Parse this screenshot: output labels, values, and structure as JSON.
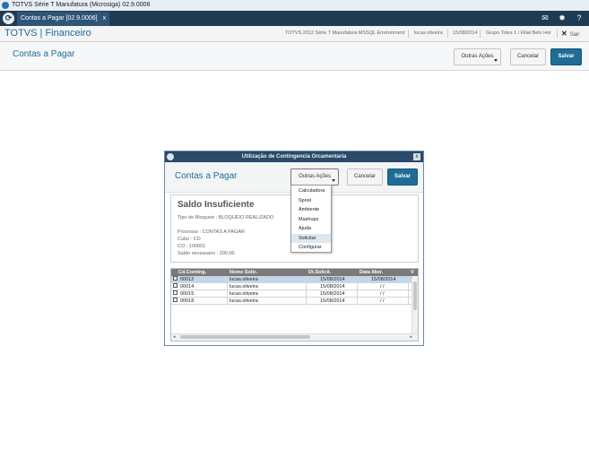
{
  "window": {
    "title": "TOTVS Série T Manufatura (Microsiga) 02.9.0006"
  },
  "tabbar": {
    "tab_label": "Contas a Pagar [02.9.0006]",
    "tab_close": "x",
    "mail_icon": "envelope-icon",
    "settings_icon": "gear-icon",
    "help_icon": "question-icon"
  },
  "module": {
    "name": "TOTVS | Financeiro",
    "environment": "TOTVS 2012 Série T Manufatura MSSQL Environment",
    "user": "lucas.oliveira",
    "date": "15/08/2014",
    "company": "Grupo Totvs 1 / Filial Belo Hor",
    "exit_label": "Sair",
    "exit_glyph": "✕"
  },
  "page": {
    "title": "Contas a Pagar",
    "other_actions": "Outras Ações",
    "cancel": "Cancelar",
    "save": "Salvar"
  },
  "dialog": {
    "title": "Utilização de Contingencia Orcamentaria",
    "close": "x",
    "header_title": "Contas a Pagar",
    "other_actions": "Outras Ações",
    "cancel": "Cancelar",
    "save": "Salvar",
    "panel": {
      "heading": "Saldo Insuficiente",
      "block_type": "Tipo de Bloqueio : BLOQUEIO REALIZADO",
      "process": "Processo : CONTAS A PAGAR",
      "cube": "Cubo : CD",
      "co": "CO : 100001",
      "balance": "Saldo necessario : 200,00"
    },
    "grid": {
      "columns": [
        "Cd.Conting.",
        "Nome Solic.",
        "Dt.Solicit.",
        "Data liber.",
        "V"
      ],
      "rows": [
        {
          "code": "00012",
          "name": "lucas.oliveira",
          "req_date": "15/08/2014",
          "release_date": "15/08/2014",
          "selected": true
        },
        {
          "code": "00014",
          "name": "lucas.oliveira",
          "req_date": "15/08/2014",
          "release_date": "/ /",
          "selected": false
        },
        {
          "code": "00015",
          "name": "lucas.oliveira",
          "req_date": "15/08/2014",
          "release_date": "/ /",
          "selected": false
        },
        {
          "code": "00018",
          "name": "lucas.oliveira",
          "req_date": "15/08/2014",
          "release_date": "/ /",
          "selected": false
        }
      ],
      "scroll_left": "◂",
      "scroll_right": "▸"
    }
  },
  "menu": {
    "items": [
      "Calculadora",
      "Spool",
      "Ambiente",
      "Mashups",
      "Ajuda",
      "Solicitar",
      "Configurar"
    ],
    "highlighted": "Solicitar"
  },
  "colors": {
    "accent": "#1f6d97",
    "dark_bar": "#1f3b54",
    "grid_header": "#7a7a7a",
    "row_selected": "#c3d7ea"
  }
}
